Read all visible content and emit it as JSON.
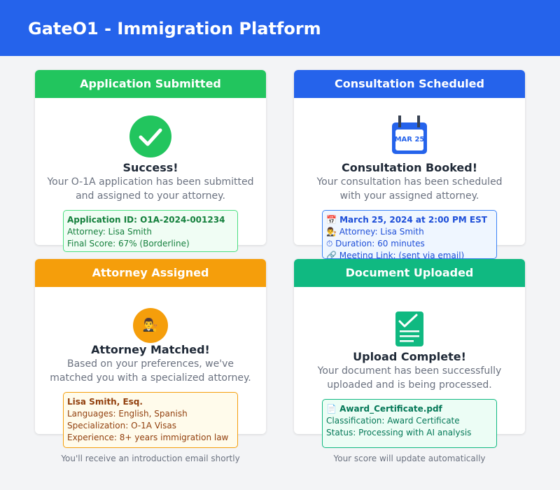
{
  "header": {
    "title": "GateO1 - Immigration Platform"
  },
  "cards": {
    "application": {
      "header": "Application Submitted",
      "title": "Success!",
      "desc_line1": "Your O-1A application has been submitted",
      "desc_line2": "and assigned to your attorney.",
      "info": [
        "Application ID: O1A-2024-001234",
        "Attorney: Lisa Smith",
        "Final Score: 67% (Borderline)"
      ],
      "icon": "check-circle-icon"
    },
    "consultation": {
      "header": "Consultation Scheduled",
      "calendar_text": "MAR 25",
      "title": "Consultation Booked!",
      "desc_line1": "Your consultation has been scheduled",
      "desc_line2": "with your assigned attorney.",
      "info": [
        "📅 March 25, 2024 at 2:00 PM EST",
        "👨‍⚖️ Attorney: Lisa Smith",
        "⏱ Duration: 60 minutes",
        "🔗 Meeting Link: (sent via email)"
      ],
      "icon": "calendar-icon"
    },
    "attorney": {
      "header": "Attorney Assigned",
      "icon_glyph": "👨‍⚖️",
      "title": "Attorney Matched!",
      "desc_line1": "Based on your preferences, we've",
      "desc_line2": "matched you with a specialized attorney.",
      "info": [
        "Lisa Smith, Esq.",
        "Languages: English, Spanish",
        "Specialization: O-1A Visas",
        "Experience: 8+ years immigration law"
      ],
      "footer": "You'll receive an introduction email shortly",
      "icon": "attorney-icon"
    },
    "document": {
      "header": "Document Uploaded",
      "title": "Upload Complete!",
      "desc_line1": "Your document has been successfully",
      "desc_line2": "uploaded and is being processed.",
      "info": [
        "📄 Award_Certificate.pdf",
        "Classification: Award Certificate",
        "Status: Processing with AI analysis"
      ],
      "footer": "Your score will update automatically",
      "icon": "document-check-icon"
    }
  },
  "colors": {
    "primary": "#2563eb",
    "success": "#22c55e",
    "warning": "#f59e0b",
    "teal": "#10b981"
  }
}
